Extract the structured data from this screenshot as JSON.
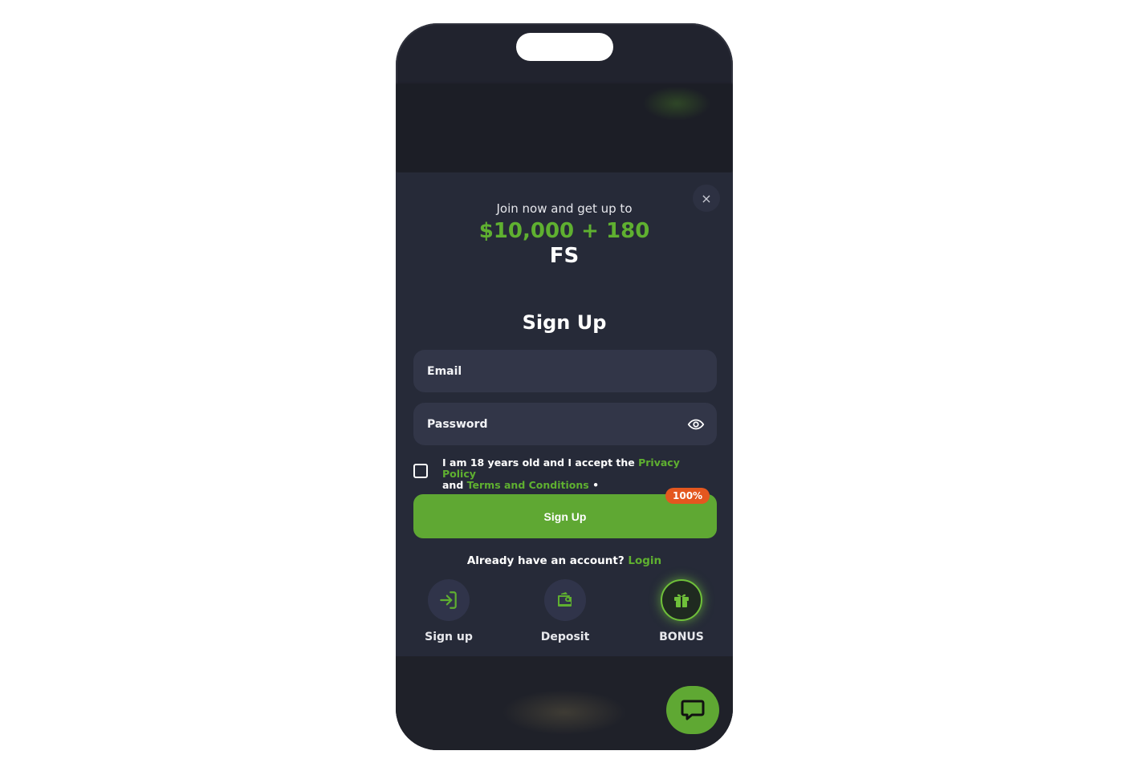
{
  "modal": {
    "close_label": "×",
    "promo_subtitle": "Join now and get up to",
    "promo_amount": "$10,000 + 180",
    "promo_unit": "FS",
    "title": "Sign Up"
  },
  "form": {
    "email_placeholder": "Email",
    "password_placeholder": "Password",
    "consent_prefix": "I am 18 years old and I accept the",
    "privacy_link": "Privacy Policy",
    "consent_and": "and",
    "terms_link": "Terms and Conditions",
    "consent_suffix": "•",
    "submit_label": "Sign Up",
    "badge": "100%",
    "already_text": "Already have an account?",
    "login_link": "Login"
  },
  "steps": [
    {
      "label": "Sign up",
      "icon": "login-arrow-icon"
    },
    {
      "label": "Deposit",
      "icon": "wallet-icon"
    },
    {
      "label": "BONUS",
      "icon": "gift-icon",
      "active": true
    }
  ],
  "colors": {
    "accent": "#5fa833",
    "badge": "#e4571f",
    "modal_bg": "#262a38",
    "field_bg": "#323648"
  },
  "chat": {
    "icon": "chat-bubble-icon"
  }
}
